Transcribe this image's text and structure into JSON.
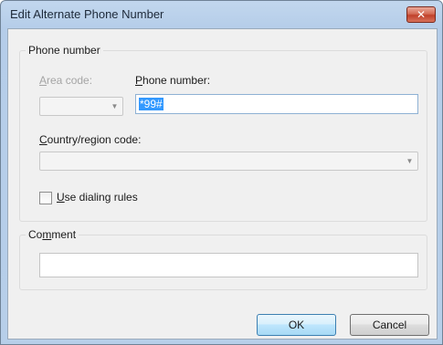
{
  "window": {
    "title": "Edit Alternate Phone Number",
    "close_glyph": "✕"
  },
  "phone_group": {
    "legend": "Phone number",
    "area_code": {
      "label_mnemonic": "A",
      "label_rest": "rea code:",
      "value": "",
      "disabled": true
    },
    "phone_number": {
      "label_mnemonic": "P",
      "label_rest": "hone number:",
      "value": "*99#",
      "selected": true
    },
    "country": {
      "label_mnemonic": "C",
      "label_rest": "ountry/region code:",
      "value": "",
      "disabled": true
    },
    "dialing_rules": {
      "label_mnemonic": "U",
      "label_rest": "se dialing rules",
      "checked": false
    }
  },
  "comment_group": {
    "legend_pre": "Co",
    "legend_mnemonic": "m",
    "legend_post": "ment",
    "value": ""
  },
  "buttons": {
    "ok": "OK",
    "cancel": "Cancel"
  },
  "icons": {
    "dropdown": "▼"
  }
}
